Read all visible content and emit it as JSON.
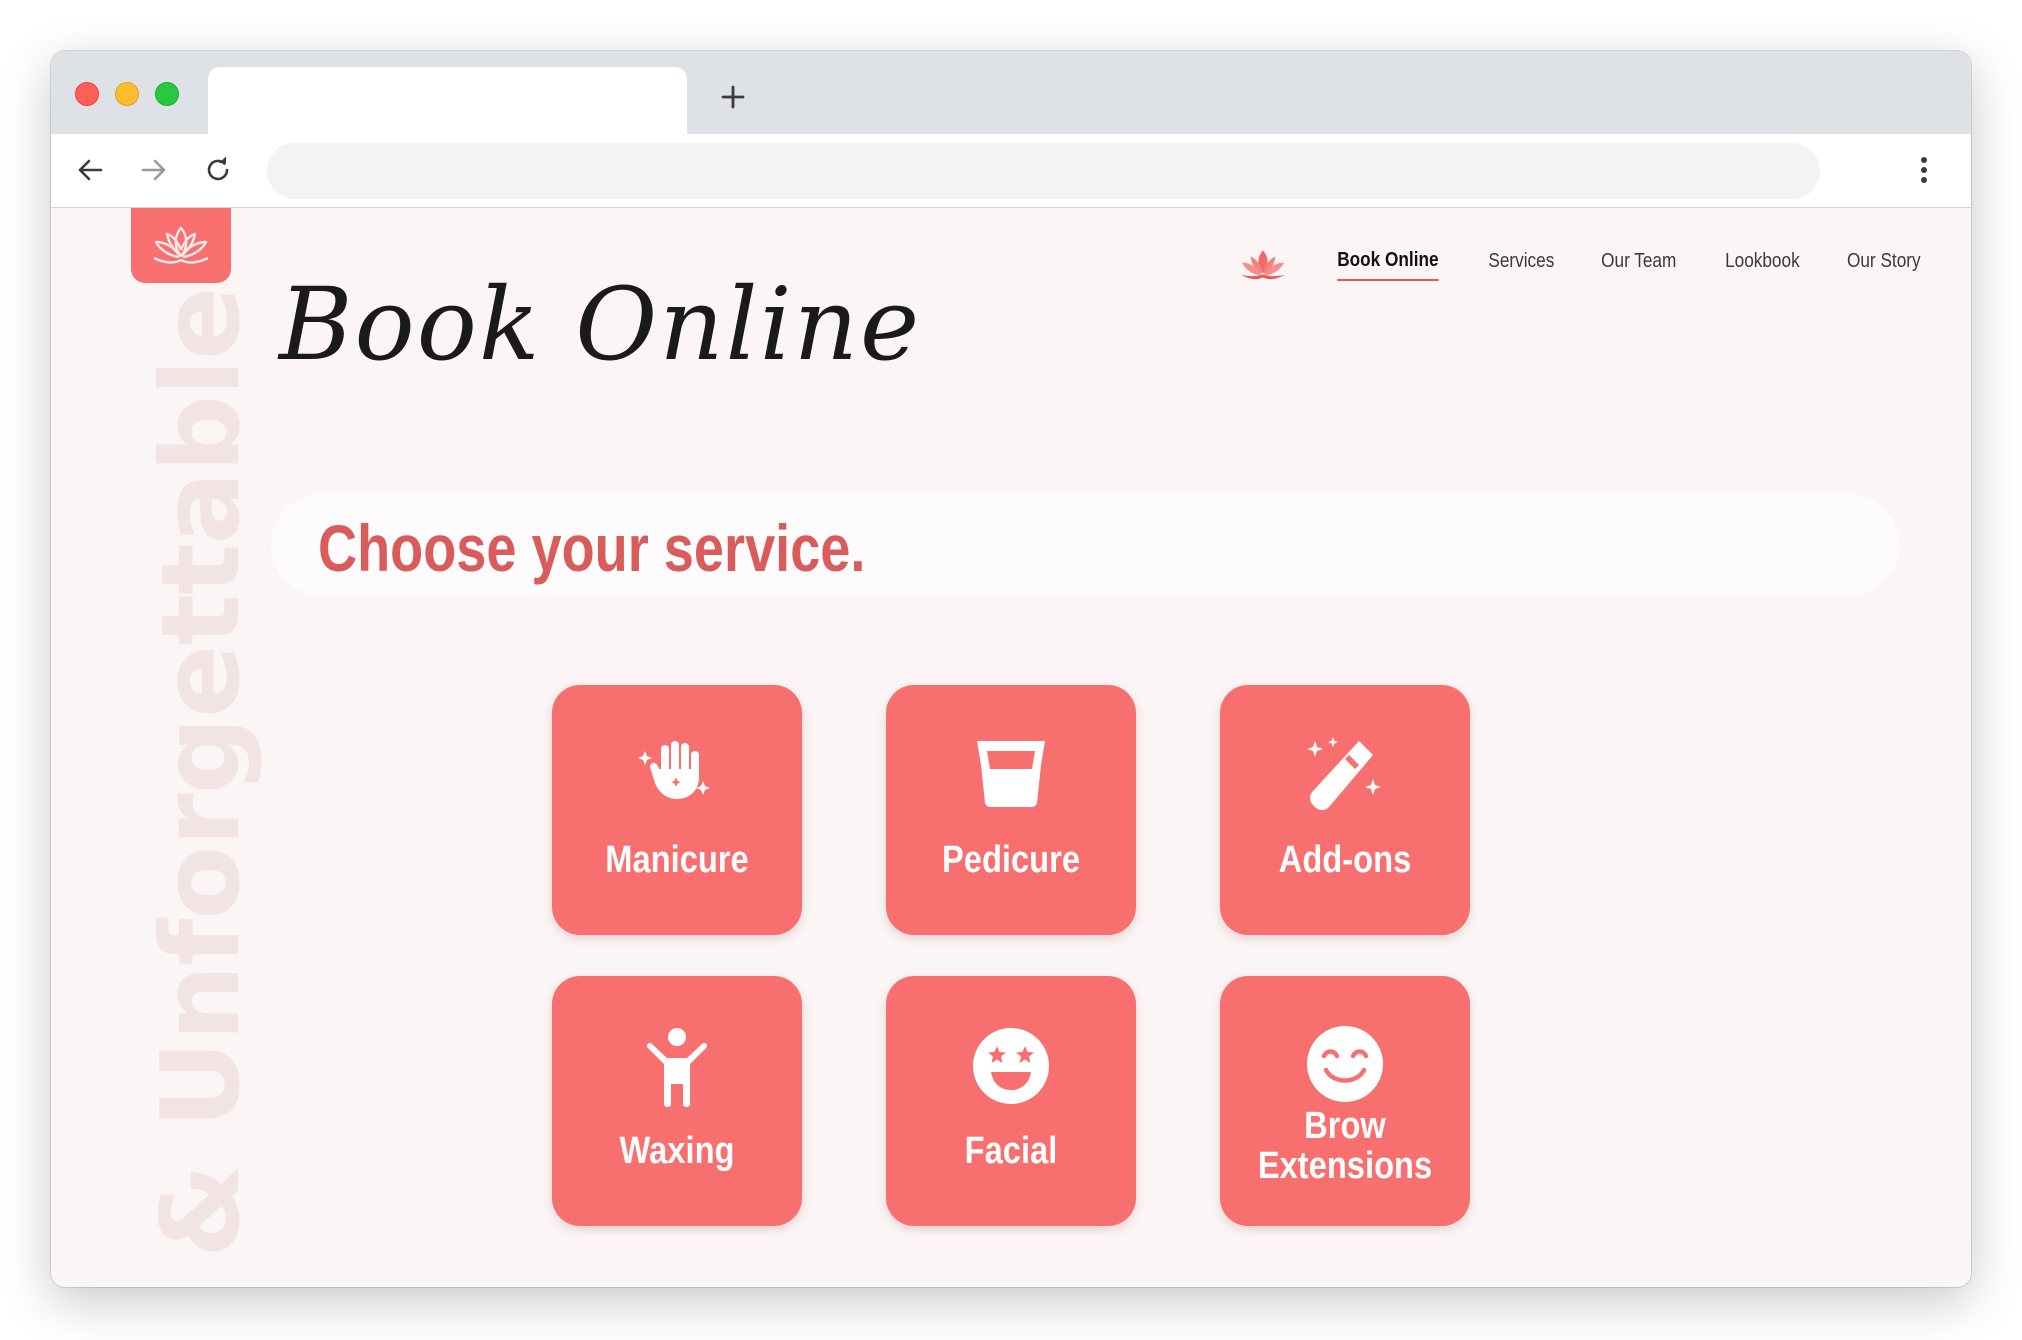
{
  "browser": {
    "tab_title": "",
    "address": "",
    "new_tab_symbol": "+"
  },
  "icons": {
    "back": "arrow-left-icon",
    "forward": "arrow-right-icon",
    "reload": "reload-icon",
    "menu": "kebab-menu-icon",
    "logo": "lotus-icon",
    "manicure": "sparkle-hand-icon",
    "pedicure": "tub-icon",
    "addons": "magic-wand-icon",
    "waxing": "person-arms-up-icon",
    "facial": "star-eyes-face-icon",
    "brow": "smiling-face-icon"
  },
  "colors": {
    "brand": "#f76f6e",
    "headline": "#d95c5d",
    "page_bg": "#fcf5f5",
    "watermark": "#f1e4e3"
  },
  "nav": {
    "items": [
      {
        "label": "Book Online",
        "active": true
      },
      {
        "label": "Services"
      },
      {
        "label": "Our Team"
      },
      {
        "label": "Lookbook"
      },
      {
        "label": "Our Story"
      }
    ]
  },
  "page": {
    "script_title": "Book Online",
    "headline": "Choose your service.",
    "watermark": "& Unforgettable"
  },
  "services": [
    {
      "label": "Manicure"
    },
    {
      "label": "Pedicure"
    },
    {
      "label": "Add-ons"
    },
    {
      "label": "Waxing"
    },
    {
      "label": "Facial"
    },
    {
      "label": "Brow Extensions",
      "line1": "Brow",
      "line2": "Extensions"
    }
  ]
}
